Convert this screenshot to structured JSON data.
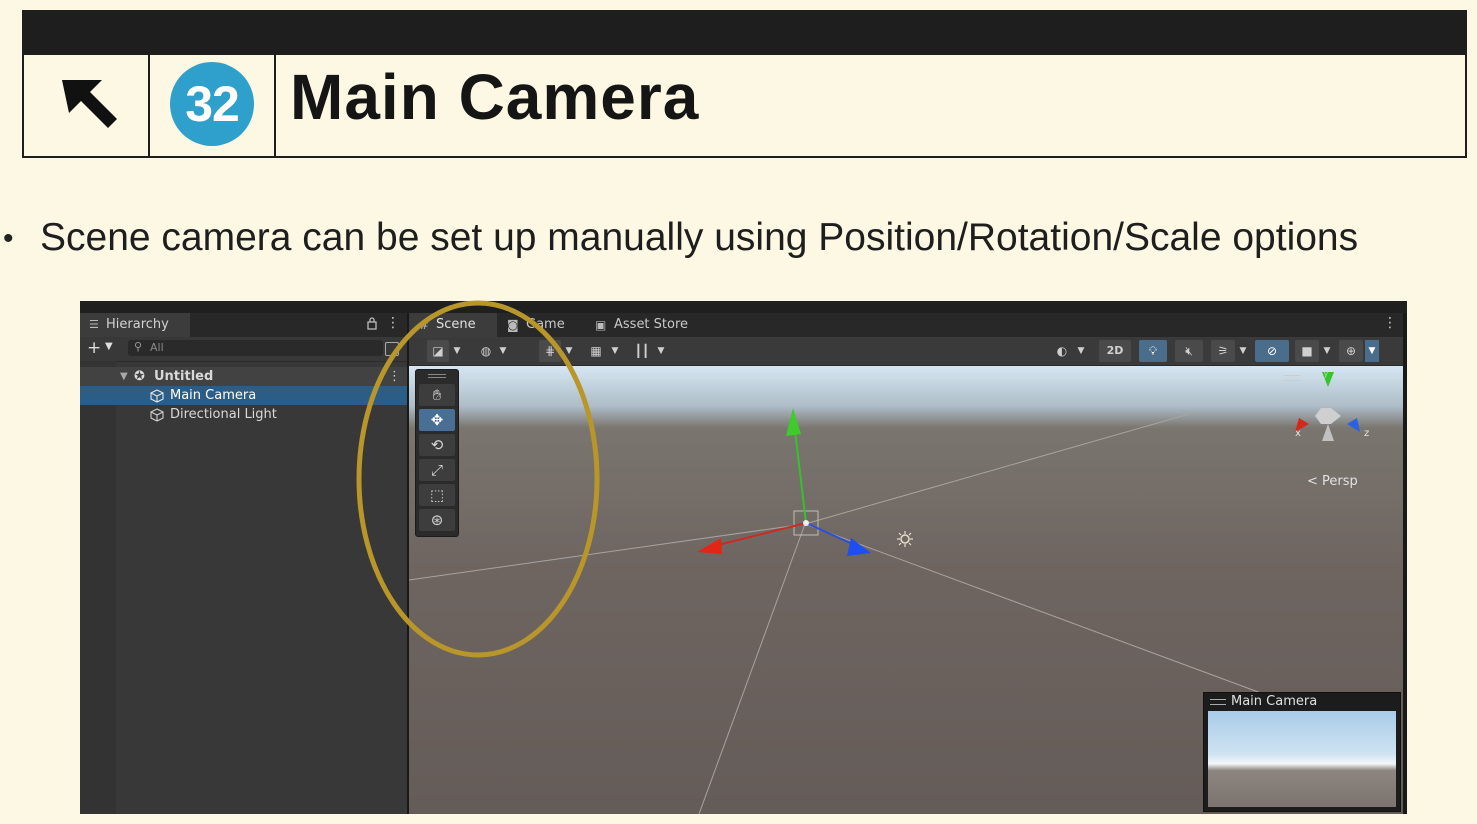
{
  "slide": {
    "number": "32",
    "title": "Main Camera",
    "bullet": "Scene camera can be set up manually using Position/Rotation/Scale options",
    "icons": {
      "back": "arrow-up-left-icon",
      "bullet": "bullet-dot-icon"
    },
    "colors": {
      "background": "#fdf8e3",
      "header_bar": "#1e1e1e",
      "number_circle": "#2f9fcb",
      "highlight_ellipse": "#b8962a"
    }
  },
  "hierarchy": {
    "tab_label": "Hierarchy",
    "search_placeholder": "All",
    "scene_name": "Untitled",
    "items": [
      {
        "label": "Main Camera",
        "selected": true,
        "icon": "cube-icon"
      },
      {
        "label": "Directional Light",
        "selected": false,
        "icon": "cube-icon"
      }
    ]
  },
  "scene_view": {
    "tabs": [
      {
        "label": "Scene",
        "icon": "scene-grid-icon",
        "active": true
      },
      {
        "label": "Game",
        "icon": "gamepad-icon",
        "active": false
      },
      {
        "label": "Asset Store",
        "icon": "bag-icon",
        "active": false
      }
    ],
    "toolbar": {
      "mode_2d": "2D"
    },
    "tools": [
      {
        "name": "hand-tool",
        "icon": "hand-icon",
        "active": false
      },
      {
        "name": "move-tool",
        "icon": "move-arrows-icon",
        "active": true
      },
      {
        "name": "rotate-tool",
        "icon": "rotate-icon",
        "active": false
      },
      {
        "name": "scale-tool",
        "icon": "scale-icon",
        "active": false
      },
      {
        "name": "rect-tool",
        "icon": "rect-icon",
        "active": false
      },
      {
        "name": "transform-tool",
        "icon": "transform-icon",
        "active": false
      }
    ],
    "orientation": {
      "projection": "Persp",
      "axes": [
        "x",
        "y",
        "z"
      ]
    },
    "camera_preview_title": "Main Camera"
  }
}
